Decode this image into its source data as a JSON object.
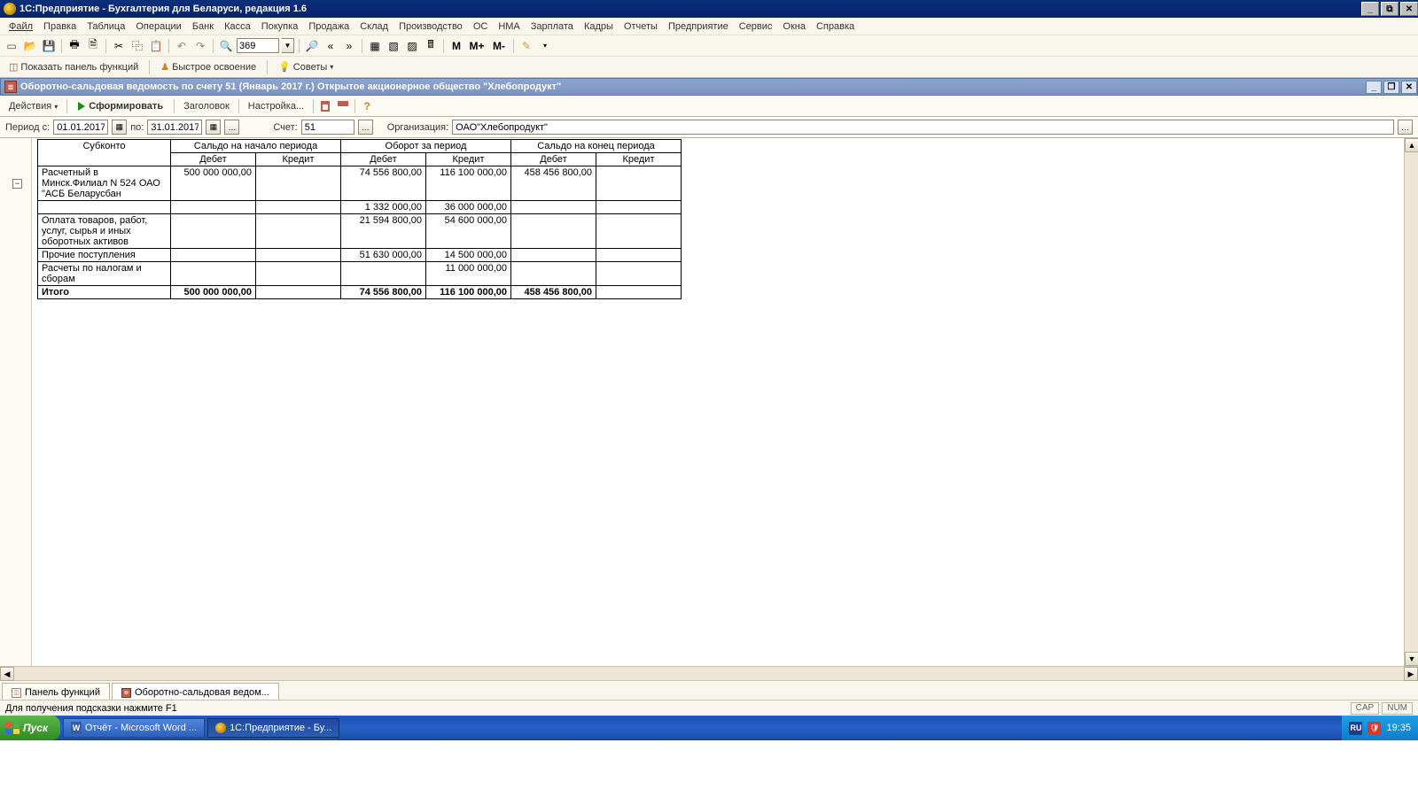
{
  "titlebar": {
    "text": "1С:Предприятие - Бухгалтерия для Беларуси, редакция 1.6"
  },
  "menu": {
    "items": [
      "Файл",
      "Правка",
      "Таблица",
      "Операции",
      "Банк",
      "Касса",
      "Покупка",
      "Продажа",
      "Склад",
      "Производство",
      "ОС",
      "НМА",
      "Зарплата",
      "Кадры",
      "Отчеты",
      "Предприятие",
      "Сервис",
      "Окна",
      "Справка"
    ]
  },
  "toolbar1": {
    "zoom": "369",
    "m1": "M",
    "m2": "M+",
    "m3": "M-"
  },
  "toolbar2": {
    "panel": "Показать панель функций",
    "quick": "Быстрое освоение",
    "tips": "Советы"
  },
  "docbar": {
    "title": "Оборотно-сальдовая ведомость по счету 51 (Январь 2017 г.) Открытое акционерное общество \"Хлебопродукт\""
  },
  "actbar": {
    "actions": "Действия",
    "form": "Сформировать",
    "header": "Заголовок",
    "setup": "Настройка..."
  },
  "par": {
    "period_lbl": "Период с:",
    "from": "01.01.2017",
    "to_lbl": "по:",
    "to": "31.01.2017",
    "acct_lbl": "Счет:",
    "acct": "51",
    "org_lbl": "Организация:",
    "org": "ОАО\"Хлебопродукт\""
  },
  "report": {
    "head": {
      "c0": "Субконто",
      "g1": "Сальдо на начало периода",
      "g2": "Оборот за период",
      "g3": "Сальдо на конец периода",
      "d": "Дебет",
      "k": "Кредит"
    },
    "rows": [
      {
        "name": "Расчетный в Минск.Филиал N 524 ОАО \"АСБ Беларусбан",
        "sd": "500 000 000,00",
        "sk": "",
        "od": "74 556 800,00",
        "ok": "116 100 000,00",
        "ed": "458 456 800,00",
        "ek": ""
      },
      {
        "name": "",
        "sd": "",
        "sk": "",
        "od": "1 332 000,00",
        "ok": "36 000 000,00",
        "ed": "",
        "ek": ""
      },
      {
        "name": "Оплата товаров, работ, услуг, сырья и иных оборотных активов",
        "sd": "",
        "sk": "",
        "od": "21 594 800,00",
        "ok": "54 600 000,00",
        "ed": "",
        "ek": ""
      },
      {
        "name": "Прочие поступления",
        "sd": "",
        "sk": "",
        "od": "51 630 000,00",
        "ok": "14 500 000,00",
        "ed": "",
        "ek": ""
      },
      {
        "name": "Расчеты по налогам и сборам",
        "sd": "",
        "sk": "",
        "od": "",
        "ok": "11 000 000,00",
        "ed": "",
        "ek": ""
      }
    ],
    "total": {
      "name": "Итого",
      "sd": "500 000 000,00",
      "sk": "",
      "od": "74 556 800,00",
      "ok": "116 100 000,00",
      "ed": "458 456 800,00",
      "ek": ""
    }
  },
  "wintabs": {
    "t1": "Панель функций",
    "t2": "Оборотно-сальдовая ведом..."
  },
  "status": {
    "hint": "Для получения подсказки нажмите F1",
    "cap": "CAP",
    "num": "NUM"
  },
  "taskbar": {
    "start": "Пуск",
    "task1": "Отчёт - Microsoft Word ...",
    "task2": "1С:Предприятие - Бу...",
    "lang": "RU",
    "time": "19:35"
  }
}
